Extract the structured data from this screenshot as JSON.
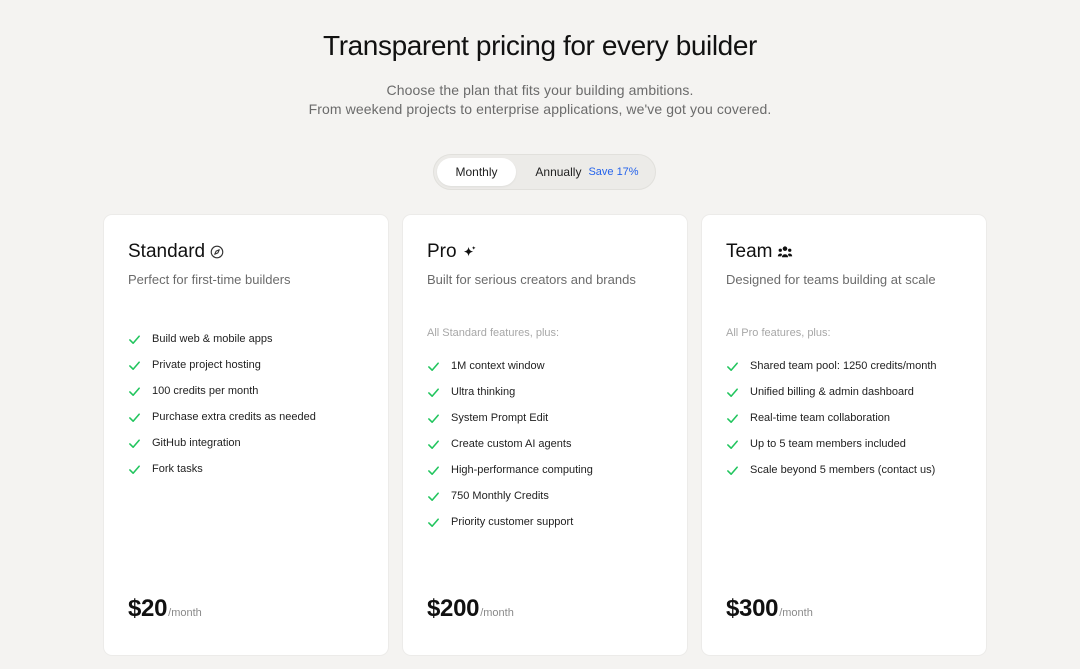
{
  "header": {
    "title": "Transparent pricing for every builder",
    "subtitle_line1": "Choose the plan that fits your building ambitions.",
    "subtitle_line2": "From weekend projects to enterprise applications, we've got you covered."
  },
  "billing_toggle": {
    "monthly_label": "Monthly",
    "annually_label": "Annually",
    "save_badge": "Save 17%",
    "selected": "Monthly",
    "save_color": "#2563eb"
  },
  "plans": [
    {
      "name": "Standard",
      "icon": "compass-icon",
      "description": "Perfect for first-time builders",
      "features_intro": "",
      "features": [
        "Build web & mobile apps",
        "Private project hosting",
        "100 credits per month",
        "Purchase extra credits as needed",
        "GitHub integration",
        "Fork tasks"
      ],
      "price": "$20",
      "period": "/month"
    },
    {
      "name": "Pro",
      "icon": "sparkle-icon",
      "description": "Built for serious creators and brands",
      "features_intro": "All Standard features, plus:",
      "features": [
        "1M context window",
        "Ultra thinking",
        "System Prompt Edit",
        "Create custom AI agents",
        "High-performance computing",
        "750 Monthly Credits",
        "Priority customer support"
      ],
      "price": "$200",
      "period": "/month"
    },
    {
      "name": "Team",
      "icon": "team-icon",
      "description": "Designed for teams building at scale",
      "features_intro": "All Pro features, plus:",
      "features": [
        "Shared team pool: 1250 credits/month",
        "Unified billing & admin dashboard",
        "Real-time team collaboration",
        "Up to 5 team members included",
        "Scale beyond 5 members (contact us)"
      ],
      "price": "$300",
      "period": "/month"
    }
  ],
  "colors": {
    "background": "#f4f3f1",
    "check": "#22c55e",
    "card": "#ffffff"
  }
}
